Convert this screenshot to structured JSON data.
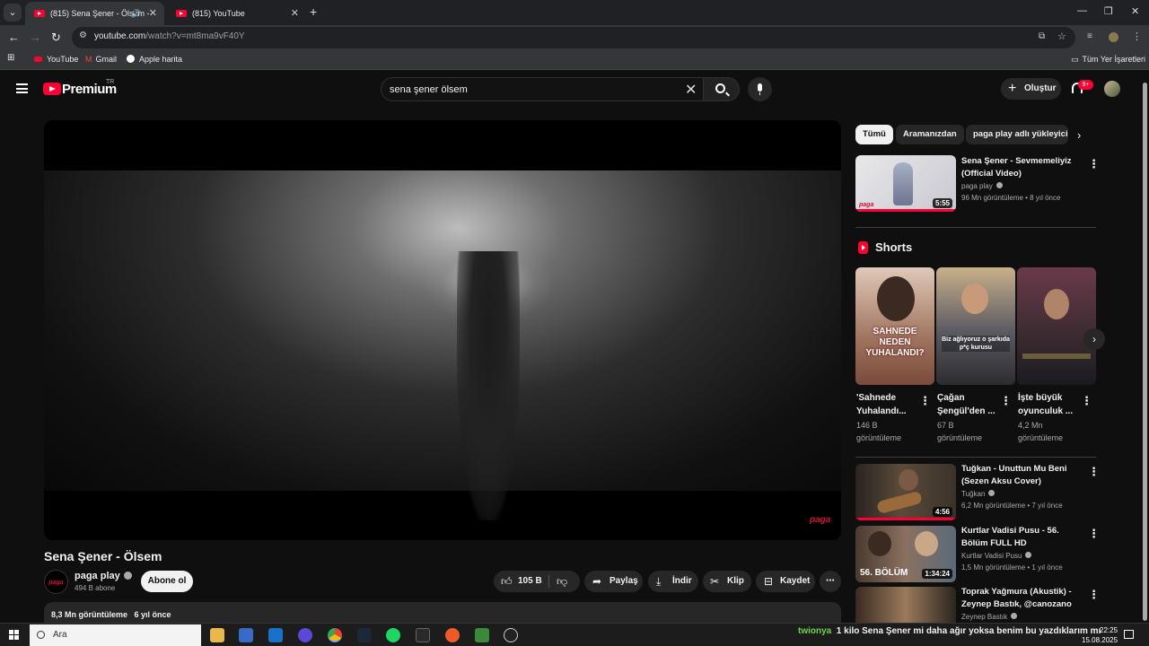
{
  "browser": {
    "tabs": [
      {
        "label": "(815) Sena Şener - Ölsem -",
        "active": true
      },
      {
        "label": "(815) YouTube",
        "active": false
      }
    ],
    "url_host": "youtube.com",
    "url_path": "/watch?v=mt8ma9vF40Y",
    "bookmarks": [
      "YouTube",
      "Gmail",
      "Apple harita"
    ],
    "all_bookmarks": "Tüm Yer İşaretleri"
  },
  "header": {
    "logo_text": "Premium",
    "logo_region": "TR",
    "search_value": "sena şener ölsem",
    "create_label": "Oluştur",
    "notification_count": "9+"
  },
  "video": {
    "title": "Sena Şener - Ölsem",
    "watermark": "paga",
    "channel_name": "paga play",
    "channel_avatar_text": "paga",
    "subscribers": "494 B abone",
    "subscribe_label": "Abone ol",
    "likes": "105 B",
    "share_label": "Paylaş",
    "download_label": "İndir",
    "clip_label": "Klip",
    "save_label": "Kaydet",
    "views": "8,3 Mn görüntüleme",
    "age": "6 yıl önce"
  },
  "chips": [
    "Tümü",
    "Aramanızdan",
    "paga play adlı yükleyiciden"
  ],
  "recommended_top": {
    "title": "Sena Şener - Sevmemeliyiz (Official Video)",
    "channel": "paga play",
    "meta": "96 Mn görüntüleme • 8 yıl önce",
    "duration": "5:55",
    "thumb_logo": "paga"
  },
  "shorts": {
    "heading": "Shorts",
    "items": [
      {
        "title": "'Sahnede Yuhalandı...",
        "views": "146 B görüntüleme",
        "overlay": "SAHNEDE NEDEN YUHALANDI?"
      },
      {
        "title": "Çağan Şengül'den ...",
        "views": "67 B görüntüleme",
        "overlay": "Biz ağlıyoruz o şarkıda p*ç kurusu"
      },
      {
        "title": "İşte büyük oyunculuk ...",
        "views": "4,2 Mn görüntüleme",
        "overlay": ""
      }
    ]
  },
  "recommended": [
    {
      "title": "Tuğkan - Unuttun Mu Beni (Sezen Aksu Cover)",
      "channel": "Tuğkan",
      "meta": "6,2 Mn görüntüleme • 7 yıl önce",
      "duration": "4:56"
    },
    {
      "title": "Kurtlar Vadisi Pusu - 56. Bölüm FULL HD",
      "channel": "Kurtlar Vadisi Pusu",
      "meta": "1,5 Mn görüntüleme • 1 yıl önce",
      "duration": "1:34:24",
      "overlay": "56. BÖLÜM"
    },
    {
      "title": "Toprak Yağmura (Akustik) - Zeynep Bastık, @canozano",
      "channel": "Zeynep Bastık",
      "meta": "",
      "duration": ""
    }
  ],
  "taskbar": {
    "search_placeholder": "Ara",
    "ticker_user": "twionya",
    "ticker_text": "1 kilo Sena Şener mi daha ağır yoksa benim bu yazdıklarım mı",
    "time": "22:25",
    "date": "15.08.2025"
  },
  "colors": {
    "brand_red": "#ff0033",
    "bg": "#0f0f0f",
    "chip": "#272727"
  }
}
